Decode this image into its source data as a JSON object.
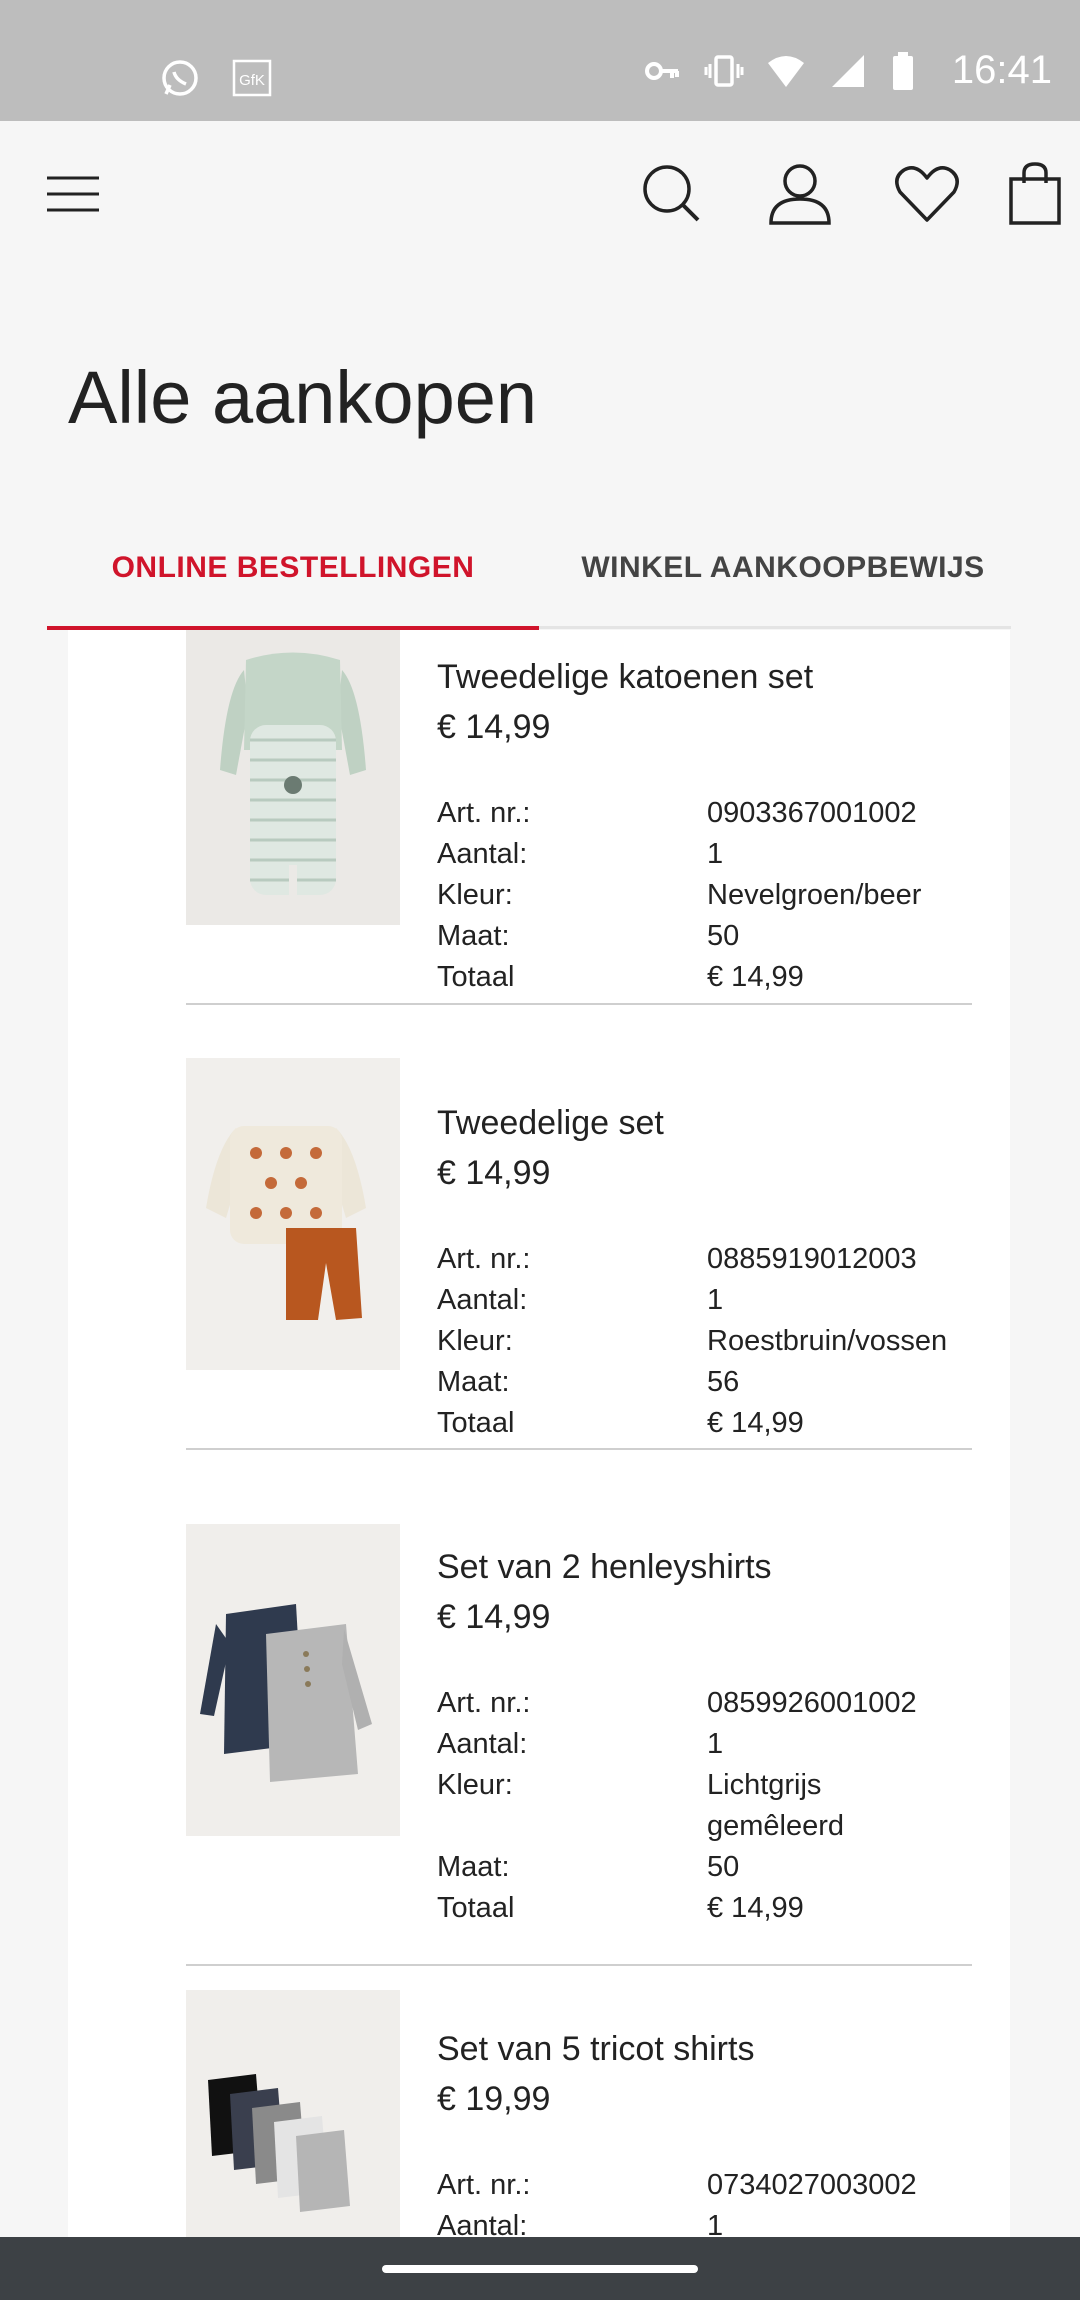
{
  "status_bar": {
    "time": "16:41",
    "left_icons": [
      "whatsapp-icon",
      "gfk-icon"
    ],
    "right_icons": [
      "key-icon",
      "vibrate-icon",
      "wifi-icon",
      "signal-icon",
      "battery-icon"
    ]
  },
  "header": {
    "icons": [
      "menu-icon",
      "search-icon",
      "account-icon",
      "favorites-icon",
      "bag-icon"
    ]
  },
  "page": {
    "title": "Alle aankopen"
  },
  "tabs": [
    {
      "label": "ONLINE BESTELLINGEN",
      "active": true
    },
    {
      "label": "WINKEL AANKOOPBEWIJS",
      "active": false
    }
  ],
  "detail_labels": {
    "art": "Art. nr.:",
    "qty": "Aantal:",
    "color": "Kleur:",
    "size": "Maat:",
    "total": "Totaal"
  },
  "items": [
    {
      "name": "Tweedelige katoenen set",
      "price": "€ 14,99",
      "art": "0903367001002",
      "qty": "1",
      "color": "Nevelgroen/beer",
      "size": "50",
      "total": "€ 14,99"
    },
    {
      "name": "Tweedelige set",
      "price": "€ 14,99",
      "art": "0885919012003",
      "qty": "1",
      "color": "Roestbruin/vossen",
      "size": "56",
      "total": "€ 14,99"
    },
    {
      "name": "Set van 2 henleyshirts",
      "price": "€ 14,99",
      "art": "0859926001002",
      "qty": "1",
      "color_line1": "Lichtgrijs",
      "color_line2": "gemêleerd",
      "size": "50",
      "total": "€ 14,99"
    },
    {
      "name": "Set van 5 tricot shirts",
      "price": "€ 19,99",
      "art": "0734027003002",
      "qty": "1"
    }
  ],
  "colors": {
    "accent": "#d0142b",
    "background": "#f6f6f6",
    "status_bar": "#bdbdbd",
    "nav_bar": "#3d4145"
  }
}
